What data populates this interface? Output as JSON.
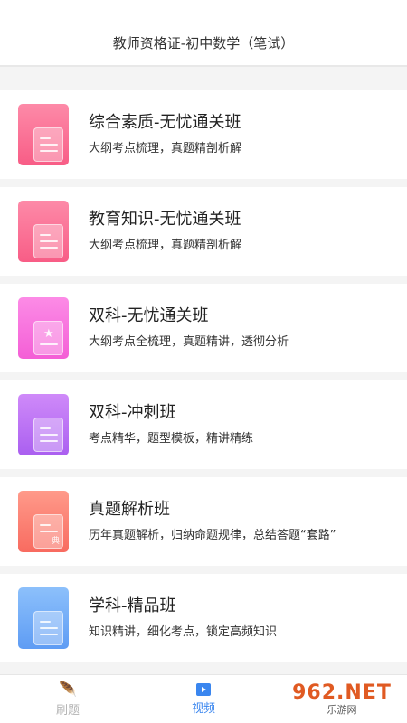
{
  "header": {
    "title": "教师资格证-初中数学（笔试）"
  },
  "courses": [
    {
      "title": "综合素质-无忧通关班",
      "subtitle": "大纲考点梳理，真题精剖析解",
      "color_top": "#fd8aa8",
      "color_bottom": "#f85d86",
      "icon": "document-icon"
    },
    {
      "title": "教育知识-无忧通关班",
      "subtitle": "大纲考点梳理，真题精剖析解",
      "color_top": "#fd8aa8",
      "color_bottom": "#f85d86",
      "icon": "document-icon"
    },
    {
      "title": "双科-无忧通关班",
      "subtitle": "大纲考点全梳理，真题精讲，透彻分析",
      "color_top": "#fc8be6",
      "color_bottom": "#f45fd6",
      "icon": "star-document-icon"
    },
    {
      "title": "双科-冲刺班",
      "subtitle": "考点精华，题型模板，精讲精练",
      "color_top": "#cf8af9",
      "color_bottom": "#aa5ff0",
      "icon": "document-icon"
    },
    {
      "title": "真题解析班",
      "subtitle": "历年真题解析，归纳命题规律，总结答题“套路”",
      "color_top": "#ff9a8a",
      "color_bottom": "#f86b60",
      "icon": "sealed-document-icon"
    },
    {
      "title": "学科-精品班",
      "subtitle": "知识精讲，细化考点，锁定高频知识",
      "color_top": "#8cc0fb",
      "color_bottom": "#5e9cf4",
      "icon": "document-icon"
    }
  ],
  "tabs": [
    {
      "label": "刷题",
      "icon": "feather-icon",
      "active": false
    },
    {
      "label": "视频",
      "icon": "video-icon",
      "active": true
    }
  ],
  "watermark": {
    "main": "962.NET",
    "sub": "乐游网"
  },
  "seal_char": "典"
}
